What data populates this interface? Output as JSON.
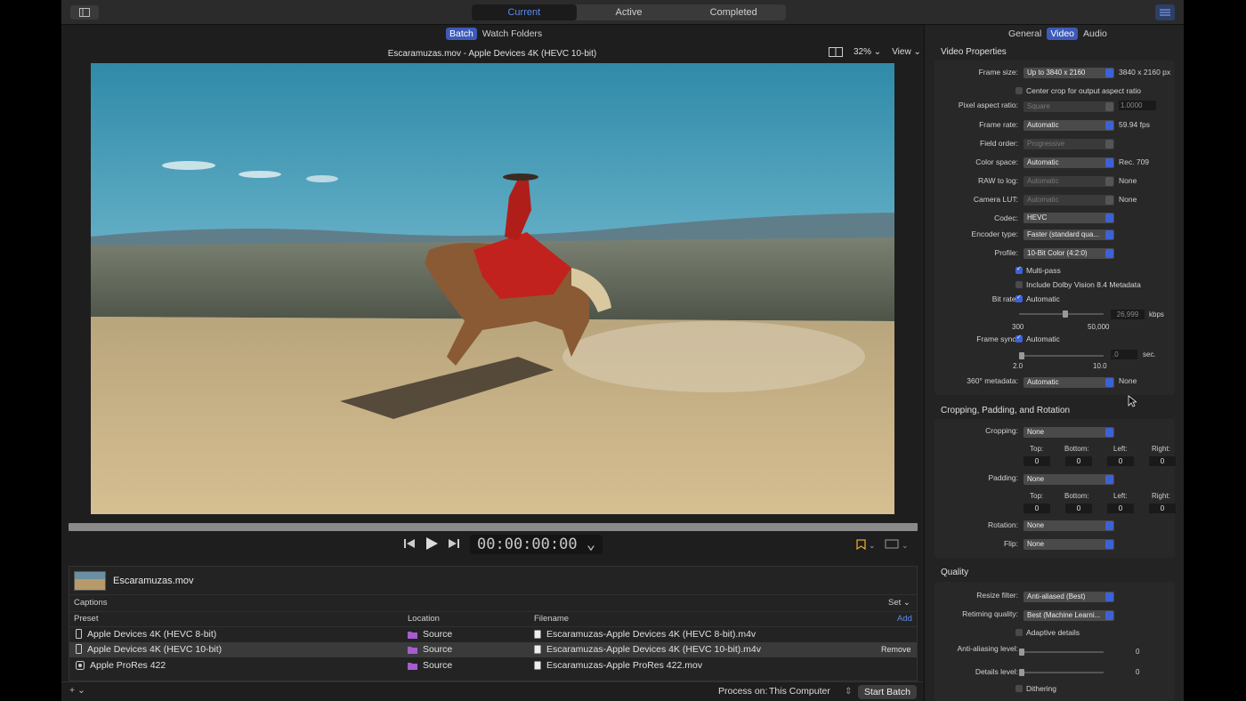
{
  "toolbar": {
    "segments": [
      "Current",
      "Active",
      "Completed"
    ]
  },
  "main": {
    "subtabs": [
      "Batch",
      "Watch Folders"
    ],
    "viewer_title": "Escaramuzas.mov - Apple Devices 4K (HEVC 10-bit)",
    "zoom": "32%",
    "view_label": "View",
    "timecode": "00:00:00:00"
  },
  "batch": {
    "source_file": "Escaramuzas.mov",
    "captions_label": "Captions",
    "set_label": "Set",
    "headers": {
      "preset": "Preset",
      "location": "Location",
      "filename": "Filename",
      "add": "Add"
    },
    "rows": [
      {
        "preset": "Apple Devices 4K (HEVC 8-bit)",
        "location": "Source",
        "filename": "Escaramuzas-Apple Devices 4K (HEVC 8-bit).m4v"
      },
      {
        "preset": "Apple Devices 4K (HEVC 10-bit)",
        "location": "Source",
        "filename": "Escaramuzas-Apple Devices 4K (HEVC 10-bit).m4v",
        "action": "Remove"
      },
      {
        "preset": "Apple ProRes 422",
        "location": "Source",
        "filename": "Escaramuzas-Apple ProRes 422.mov"
      }
    ]
  },
  "footer": {
    "process_label": "Process on:",
    "process_value": "This Computer",
    "start_label": "Start Batch"
  },
  "inspector": {
    "tabs": [
      "General",
      "Video",
      "Audio"
    ],
    "video_props": {
      "title": "Video Properties",
      "frame_size_label": "Frame size:",
      "frame_size": "Up to 3840 x 2160",
      "frame_size_px": "3840 x 2160 px",
      "center_crop": "Center crop for output aspect ratio",
      "par_label": "Pixel aspect ratio:",
      "par": "Square",
      "par_value": "1.0000",
      "frame_rate_label": "Frame rate:",
      "frame_rate": "Automatic",
      "fps": "59.94 fps",
      "field_order_label": "Field order:",
      "field_order": "Progressive",
      "color_space_label": "Color space:",
      "color_space": "Automatic",
      "color_space_value": "Rec. 709",
      "raw_label": "RAW to log:",
      "raw": "Automatic",
      "raw_value": "None",
      "lut_label": "Camera LUT:",
      "lut": "Automatic",
      "lut_value": "None",
      "codec_label": "Codec:",
      "codec": "HEVC",
      "encoder_label": "Encoder type:",
      "encoder": "Faster (standard qua...",
      "profile_label": "Profile:",
      "profile": "10-Bit Color (4:2:0)",
      "multipass": "Multi-pass",
      "dolby": "Include Dolby Vision 8.4 Metadata",
      "bitrate_label": "Bit rate:",
      "bitrate_auto": "Automatic",
      "bitrate_value": "26,999",
      "bitrate_unit": "kbps",
      "bitrate_min": "300",
      "bitrate_max": "50,000",
      "sync_label": "Frame sync:",
      "sync_auto": "Automatic",
      "sync_value": ".0",
      "sync_unit": "sec.",
      "sync_min": "2.0",
      "sync_max": "10.0",
      "meta360_label": "360° metadata:",
      "meta360": "Automatic",
      "meta360_value": "None"
    },
    "crop": {
      "title": "Cropping, Padding, and Rotation",
      "cropping_label": "Cropping:",
      "cropping": "None",
      "padding_label": "Padding:",
      "padding": "None",
      "rotation_label": "Rotation:",
      "rotation": "None",
      "flip_label": "Flip:",
      "flip": "None",
      "top": "Top:",
      "bottom": "Bottom:",
      "left": "Left:",
      "right": "Right:",
      "zero": "0"
    },
    "quality": {
      "title": "Quality",
      "resize_label": "Resize filter:",
      "resize": "Anti-aliased (Best)",
      "retiming_label": "Retiming quality:",
      "retiming": "Best (Machine Learni...",
      "adaptive": "Adaptive details",
      "aa_label": "Anti-aliasing level:",
      "aa_value": "0",
      "details_label": "Details level:",
      "details_value": "0",
      "dithering": "Dithering"
    }
  }
}
